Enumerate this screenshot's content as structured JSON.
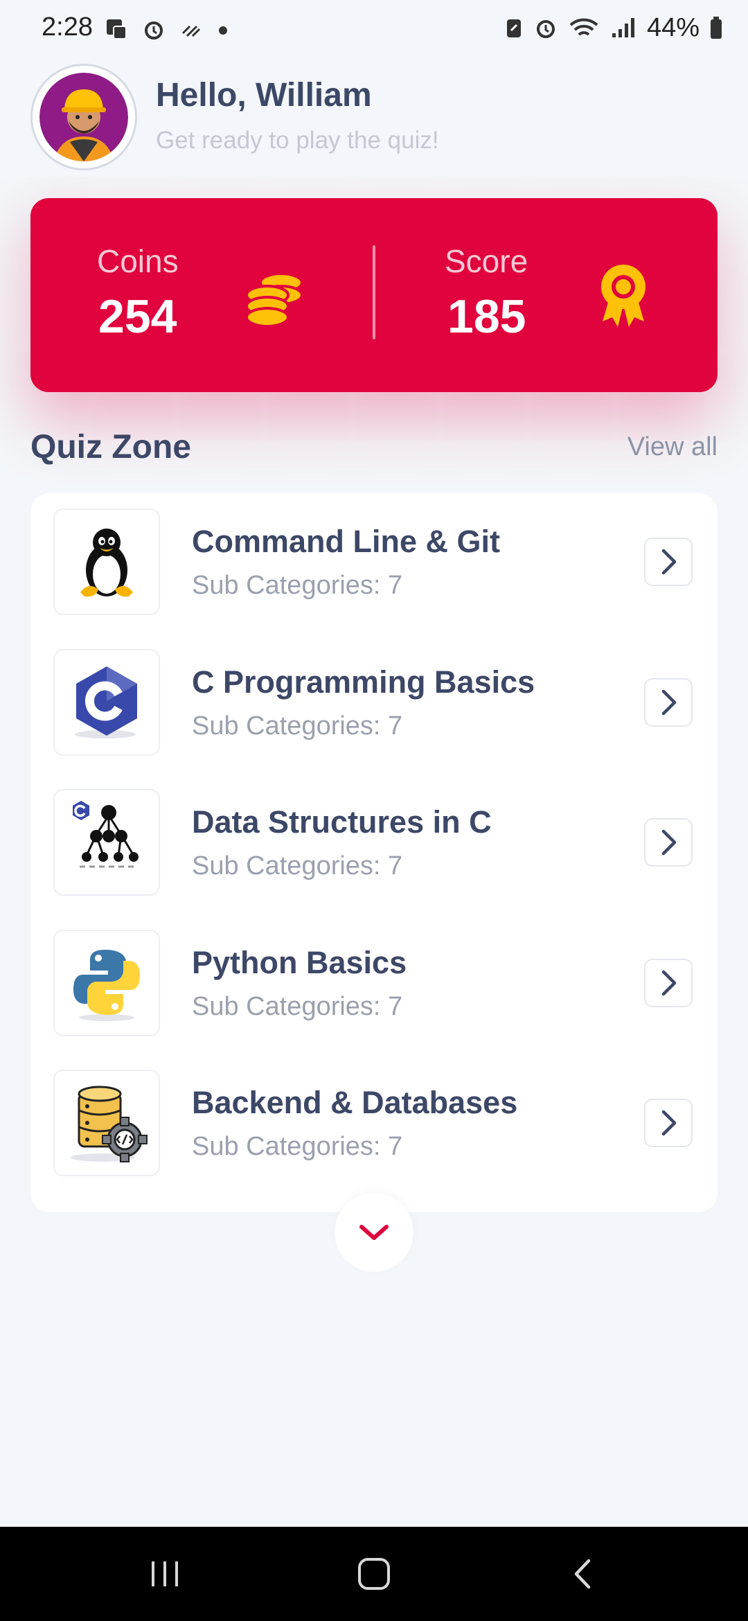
{
  "status_bar": {
    "time": "2:28",
    "battery_percent": "44%",
    "icons": [
      "notification-icon",
      "alarm-icon",
      "gesture-icon",
      "dot-icon",
      "battery-saver-icon",
      "alarm-icon",
      "wifi-icon",
      "signal-icon",
      "battery-icon"
    ]
  },
  "header": {
    "greeting": "Hello, William",
    "subtitle": "Get ready to play the quiz!"
  },
  "stats": {
    "coins_label": "Coins",
    "coins_value": "254",
    "score_label": "Score",
    "score_value": "185",
    "card_color": "#E0033D",
    "icon_color": "#FFC107"
  },
  "quiz_zone": {
    "title": "Quiz Zone",
    "view_all": "View all",
    "items": [
      {
        "title": "Command Line & Git",
        "subtitle": "Sub Categories: 7",
        "icon": "linux-penguin-icon"
      },
      {
        "title": "C Programming Basics",
        "subtitle": "Sub Categories: 7",
        "icon": "c-language-icon"
      },
      {
        "title": "Data Structures in C",
        "subtitle": "Sub Categories: 7",
        "icon": "tree-structure-icon"
      },
      {
        "title": "Python Basics",
        "subtitle": "Sub Categories: 7",
        "icon": "python-icon"
      },
      {
        "title": "Backend & Databases",
        "subtitle": "Sub Categories: 7",
        "icon": "database-gear-icon"
      }
    ]
  },
  "colors": {
    "background": "#F3F6FA",
    "primary_text": "#3D4766",
    "accent": "#E0033D"
  }
}
